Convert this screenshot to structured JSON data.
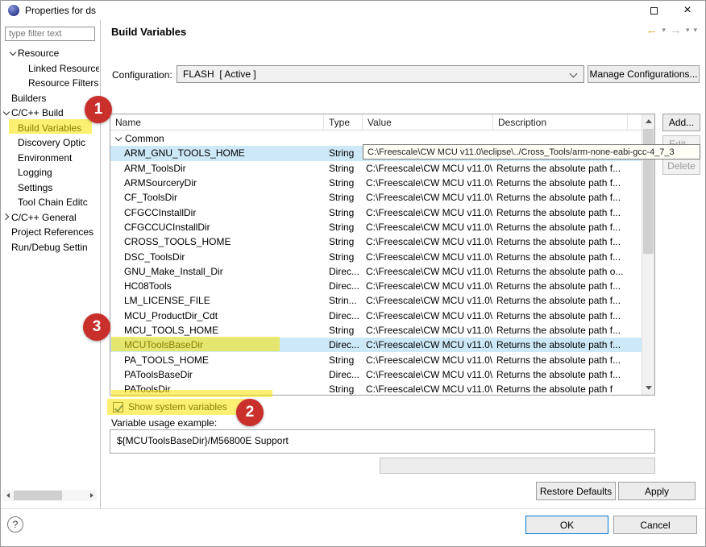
{
  "window": {
    "title": "Properties for ds"
  },
  "icons": {
    "close": "×",
    "back": "←",
    "forward": "→",
    "dropdown": "▾"
  },
  "sidebar": {
    "filter_placeholder": "type filter text",
    "tree": [
      {
        "label": "Resource",
        "level": 1,
        "chevron": "down"
      },
      {
        "label": "Linked Resource",
        "level": 2
      },
      {
        "label": "Resource Filters",
        "level": 2
      },
      {
        "label": "Builders",
        "level": 0
      },
      {
        "label": "C/C++ Build",
        "level": 0,
        "chevron": "down"
      },
      {
        "label": "Build Variables",
        "level": 1,
        "selected": true
      },
      {
        "label": "Discovery Optic",
        "level": 1
      },
      {
        "label": "Environment",
        "level": 1
      },
      {
        "label": "Logging",
        "level": 1
      },
      {
        "label": "Settings",
        "level": 1
      },
      {
        "label": "Tool Chain Editc",
        "level": 1
      },
      {
        "label": "C/C++ General",
        "level": 0,
        "chevron": "right"
      },
      {
        "label": "Project References",
        "level": 0
      },
      {
        "label": "Run/Debug Settin",
        "level": 0
      }
    ]
  },
  "header": {
    "title": "Build Variables"
  },
  "config": {
    "label": "Configuration:",
    "value": "FLASH  [ Active ]",
    "manage_button": "Manage Configurations..."
  },
  "table": {
    "columns": [
      "Name",
      "Type",
      "Value",
      "Description"
    ],
    "group": "Common",
    "rows": [
      {
        "name": "ARM_GNU_TOOLS_HOME",
        "type": "String",
        "value": "C:\\Freescale\\CW MCU v11.0\\eclipse\\../Cross_Tools/arm-none-eabi-gcc-4_7_3",
        "description": "",
        "selected": true
      },
      {
        "name": "ARM_ToolsDir",
        "type": "String",
        "value": "C:\\Freescale\\CW MCU v11.0\\...",
        "description": "Returns the absolute path f..."
      },
      {
        "name": "ARMSourceryDir",
        "type": "String",
        "value": "C:\\Freescale\\CW MCU v11.0\\...",
        "description": "Returns the absolute path f..."
      },
      {
        "name": "CF_ToolsDir",
        "type": "String",
        "value": "C:\\Freescale\\CW MCU v11.0\\...",
        "description": "Returns the absolute path f..."
      },
      {
        "name": "CFGCCInstallDir",
        "type": "String",
        "value": "C:\\Freescale\\CW MCU v11.0\\...",
        "description": "Returns the absolute path f..."
      },
      {
        "name": "CFGCCUCInstallDir",
        "type": "String",
        "value": "C:\\Freescale\\CW MCU v11.0\\...",
        "description": "Returns the absolute path f..."
      },
      {
        "name": "CROSS_TOOLS_HOME",
        "type": "String",
        "value": "C:\\Freescale\\CW MCU v11.0\\...",
        "description": "Returns the absolute path f..."
      },
      {
        "name": "DSC_ToolsDir",
        "type": "String",
        "value": "C:\\Freescale\\CW MCU v11.0\\...",
        "description": "Returns the absolute path f..."
      },
      {
        "name": "GNU_Make_Install_Dir",
        "type": "Direc...",
        "value": "C:\\Freescale\\CW MCU v11.0\\...",
        "description": "Returns the absolute path o..."
      },
      {
        "name": "HC08Tools",
        "type": "Direc...",
        "value": "C:\\Freescale\\CW MCU v11.0\\...",
        "description": "Returns the absolute path f..."
      },
      {
        "name": "LM_LICENSE_FILE",
        "type": "Strin...",
        "value": "C:\\Freescale\\CW MCU v11.0\\...",
        "description": "Returns the absolute path f..."
      },
      {
        "name": "MCU_ProductDir_Cdt",
        "type": "Direc...",
        "value": "C:\\Freescale\\CW MCU v11.0\\...",
        "description": "Returns the absolute path f..."
      },
      {
        "name": "MCU_TOOLS_HOME",
        "type": "String",
        "value": "C:\\Freescale\\CW MCU v11.0\\...",
        "description": "Returns the absolute path f..."
      },
      {
        "name": "MCUToolsBaseDir",
        "type": "Direc...",
        "value": "C:\\Freescale\\CW MCU v11.0\\...",
        "description": "Returns the absolute path f...",
        "selected": true
      },
      {
        "name": "PA_TOOLS_HOME",
        "type": "String",
        "value": "C:\\Freescale\\CW MCU v11.0\\...",
        "description": "Returns the absolute path f..."
      },
      {
        "name": "PAToolsBaseDir",
        "type": "Direc...",
        "value": "C:\\Freescale\\CW MCU v11.0\\...",
        "description": "Returns the absolute path f..."
      },
      {
        "name": "PAToolsDir",
        "type": "String",
        "value": "C:\\Freescale\\CW MCU v11.0\\",
        "description": "Returns the absolute path f"
      }
    ]
  },
  "tooltip": {
    "text": "C:\\Freescale\\CW MCU v11.0\\eclipse\\../Cross_Tools/arm-none-eabi-gcc-4_7_3"
  },
  "actions": {
    "add": "Add...",
    "edit": "Edit...",
    "delete": "Delete"
  },
  "options": {
    "show_system_variables": "Show system variables",
    "checked": true
  },
  "usage": {
    "label": "Variable usage example:",
    "value": "${MCUToolsBaseDir}/M56800E Support"
  },
  "buttons": {
    "restore_defaults": "Restore Defaults",
    "apply": "Apply",
    "ok": "OK",
    "cancel": "Cancel",
    "help": "?"
  },
  "annotations": {
    "step1": "1",
    "step2": "2",
    "step3": "3"
  },
  "colors": {
    "highlight": "#fae400",
    "badge": "#c9302c",
    "selection": "#cde8f6",
    "accent": "#0078d7"
  }
}
